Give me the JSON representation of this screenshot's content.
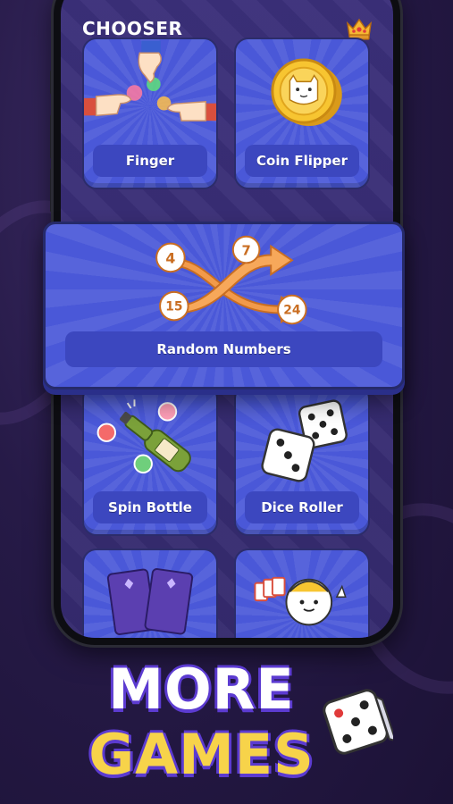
{
  "app": {
    "title": "CHOOSER",
    "crown_icon": "crown-icon"
  },
  "tiles": [
    {
      "id": "finger",
      "label": "Finger",
      "icon": "finger-touch-icon"
    },
    {
      "id": "coin",
      "label": "Coin Flipper",
      "icon": "coin-icon"
    },
    {
      "id": "bottle",
      "label": "Spin Bottle",
      "icon": "bottle-icon"
    },
    {
      "id": "dice",
      "label": "Dice Roller",
      "icon": "dice-icon"
    },
    {
      "id": "cards",
      "label": "",
      "icon": "tarot-cards-icon"
    },
    {
      "id": "hero",
      "label": "",
      "icon": "mascot-icon"
    }
  ],
  "featured": {
    "label": "Random Numbers",
    "numbers": [
      "4",
      "7",
      "15",
      "24"
    ],
    "icon": "shuffle-arrows-icon"
  },
  "promo": {
    "line1": "MORE",
    "line2": "GAMES"
  },
  "colors": {
    "tile_blue": "#4a58d8",
    "label_blue": "#3c47bf",
    "arrow_orange": "#f29a4a",
    "promo_yellow": "#f7d34a",
    "background_purple": "#261a47"
  }
}
